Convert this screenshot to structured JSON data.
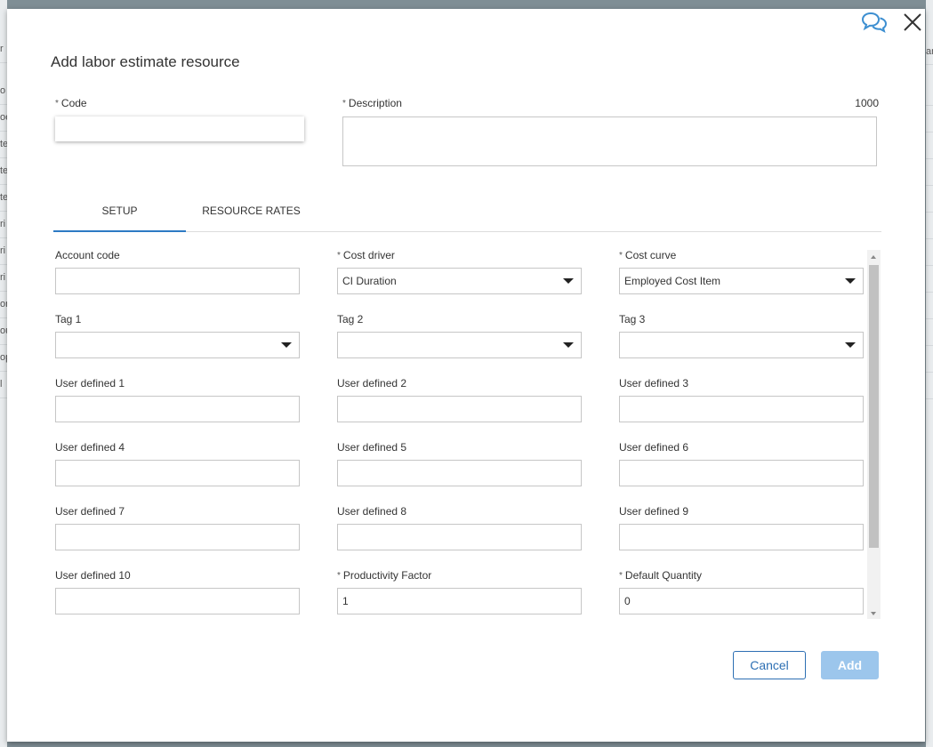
{
  "dialog": {
    "title": "Add labor estimate resource",
    "cancel_label": "Cancel",
    "add_label": "Add"
  },
  "code": {
    "label": "Code",
    "required": "*",
    "value": ""
  },
  "description": {
    "label": "Description",
    "required": "*",
    "value": "",
    "char_limit": "1000"
  },
  "tabs": [
    {
      "label": "SETUP",
      "active": true
    },
    {
      "label": "RESOURCE RATES",
      "active": false
    }
  ],
  "setup": {
    "account_code": {
      "label": "Account code",
      "value": ""
    },
    "cost_driver": {
      "label": "Cost driver",
      "required": "*",
      "value": "CI Duration"
    },
    "cost_curve": {
      "label": "Cost curve",
      "required": "*",
      "value": "Employed Cost Item"
    },
    "tag1": {
      "label": "Tag 1",
      "value": ""
    },
    "tag2": {
      "label": "Tag 2",
      "value": ""
    },
    "tag3": {
      "label": "Tag 3",
      "value": ""
    },
    "ud1": {
      "label": "User defined 1",
      "value": ""
    },
    "ud2": {
      "label": "User defined 2",
      "value": ""
    },
    "ud3": {
      "label": "User defined 3",
      "value": ""
    },
    "ud4": {
      "label": "User defined 4",
      "value": ""
    },
    "ud5": {
      "label": "User defined 5",
      "value": ""
    },
    "ud6": {
      "label": "User defined 6",
      "value": ""
    },
    "ud7": {
      "label": "User defined 7",
      "value": ""
    },
    "ud8": {
      "label": "User defined 8",
      "value": ""
    },
    "ud9": {
      "label": "User defined 9",
      "value": ""
    },
    "ud10": {
      "label": "User defined 10",
      "value": ""
    },
    "productivity_factor": {
      "label": "Productivity Factor",
      "required": "*",
      "value": "1"
    },
    "default_quantity": {
      "label": "Default Quantity",
      "required": "*",
      "value": "0"
    }
  },
  "background": {
    "left_fragments": [
      "r",
      "o",
      "oe",
      "te",
      "te",
      "te",
      "ri",
      "ri",
      "ri",
      "or",
      "ou",
      "op",
      "l"
    ],
    "right_fragments": [
      "ar"
    ]
  },
  "colors": {
    "accent": "#2d7ac4",
    "add_disabled": "#9cc6ec",
    "overlay": "#7f8e95"
  },
  "icons": {
    "chat": "chat-bubbles-icon",
    "close": "close-icon"
  }
}
